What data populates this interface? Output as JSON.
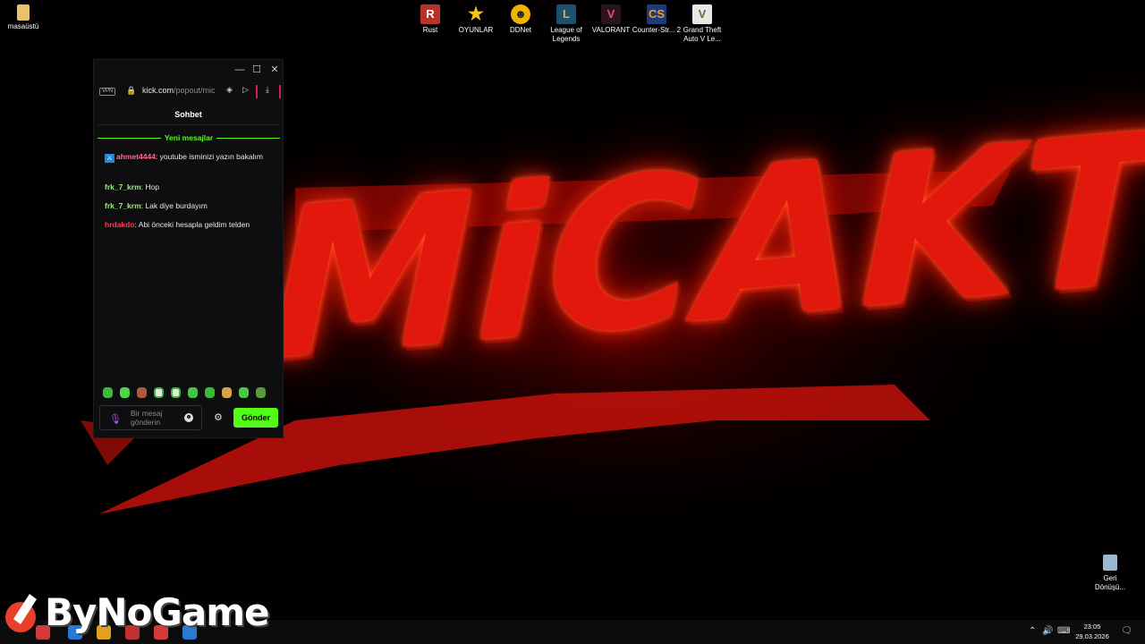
{
  "desktop": {
    "left_icon": {
      "label": "masaüstü",
      "icon": "folder-icon"
    },
    "icons": [
      {
        "label": "Rust",
        "icon": "rust-icon",
        "color": "#c0392b"
      },
      {
        "label": "OYUNLAR",
        "icon": "star-icon",
        "color": "#f5c518"
      },
      {
        "label": "DDNet",
        "icon": "ddnet-icon",
        "color": "#f0b400"
      },
      {
        "label": "League of Legends",
        "icon": "league-icon",
        "color": "#1d4f6e"
      },
      {
        "label": "VALORANT",
        "icon": "valorant-icon",
        "color": "#d4344a"
      },
      {
        "label": "Counter-Str... 2",
        "icon": "counter-strike-icon",
        "color": "#1e3a78"
      },
      {
        "label": "Grand Theft Auto V Le...",
        "icon": "gta-icon",
        "color": "#4a7c2a"
      }
    ],
    "recycle_bin": {
      "label": "Geri Dönüşü...",
      "icon": "recycle-bin-icon"
    }
  },
  "wallpaper": {
    "text": "MiCAKT",
    "color": "#e3180c"
  },
  "browser": {
    "vpn_label": "VPN",
    "url_host": "kick.com",
    "url_path": "/popout/mic",
    "window_buttons": {
      "minimize": "—",
      "maximize": "☐",
      "close": "✕"
    }
  },
  "chat": {
    "title": "Sohbet",
    "new_messages_label": "Yeni mesajlar",
    "accent": "#53fc18",
    "messages": [
      {
        "user": "ahmet4444",
        "text": ": youtube isminizi yazın bakalım",
        "color": "#ff6b8a",
        "badge": "moderator-badge"
      },
      {
        "user": "frk_7_krm",
        "text": ": Hop",
        "color": "#9cf07d"
      },
      {
        "user": "frk_7_krm",
        "text": ": Lak diye burdayım",
        "color": "#9cf07d"
      },
      {
        "user": "hrdakdo",
        "text": ": Abi önceki hesapla geldim telden",
        "color": "#ff3b4e"
      }
    ],
    "input_placeholder": "Bir mesaj gönderin",
    "send_label": "Gönder"
  },
  "taskbar": {
    "time": "23:05",
    "date": "29.03.2026"
  },
  "watermark": {
    "text": "ByNoGame"
  }
}
